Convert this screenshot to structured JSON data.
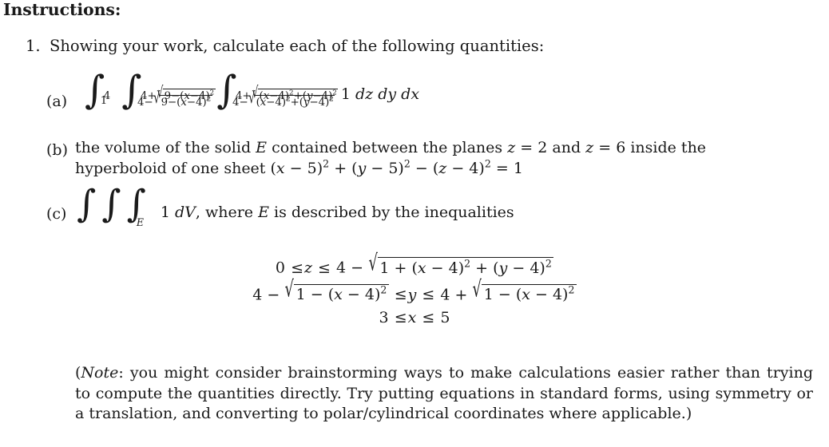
{
  "document": {
    "heading": "Instructions:",
    "item_number": "1.",
    "item_prompt": "Showing your work, calculate each of the following quantities:",
    "labels": {
      "a": "(a)",
      "b": "(b)",
      "c": "(c)"
    }
  },
  "part_a": {
    "description": "triple integral in rectangular coordinates",
    "outer_integral": {
      "lower": "1",
      "upper": "4",
      "variable": "x"
    },
    "middle_integral": {
      "lower": "4−√(9−(x−4)²)",
      "upper": "4+√(9−(x−4)²)",
      "variable": "y"
    },
    "inner_integral": {
      "lower": "4−√((x−4)²+(y−4)²)",
      "upper": "4+√((x−4)²+(y−4)²)",
      "variable": "z"
    },
    "integrand": "1",
    "differentials": "dz dy dx",
    "tokens": {
      "one": "1",
      "dz": "dz",
      "dy": "dy",
      "dx": "dx",
      "four": "4",
      "one_lim": "1",
      "nine": "9",
      "plus": "+",
      "minus": "−",
      "x": "x",
      "y": "y",
      "paren_open": "(",
      "paren_close": ")",
      "sqrt_glyph": "√",
      "exp2": "2"
    }
  },
  "part_b": {
    "line1": "the volume of the solid E contained between the planes z = 2 and z = 6 inside the",
    "line2": "hyperboloid of one sheet (x − 5)² + (y − 5)² − (z − 4)² = 1",
    "segments": {
      "s1": "the volume of the solid",
      "solid_symbol": "E",
      "s2": "contained between the planes",
      "z1": "z",
      "eq1": "=",
      "val1": "2",
      "and_word": "and",
      "z2": "z",
      "eq2": "=",
      "val2": "6",
      "s3": "inside the",
      "s4": "hyperboloid of one sheet",
      "plane_z_low": "2",
      "plane_z_high": "6"
    },
    "equation": "(x − 5)² + (y − 5)² − (z − 4)² = 1"
  },
  "part_c": {
    "integral_subscript": "E",
    "integrand": "1",
    "differential": "dV",
    "text_after": ", where",
    "region_symbol": "E",
    "text_end": "is described by the inequalities",
    "inequalities": [
      "0 ≤ z ≤ 4 − √(1 + (x − 4)² + (y − 4)²)",
      "4 − √(1 − (x − 4)²) ≤ y ≤ 4 + √(1 − (x − 4)²)",
      "3 ≤ x ≤ 5"
    ],
    "ineq1": {
      "lower": "0",
      "var": "z",
      "rhs_lead": "4",
      "op": "−",
      "inside": "1 + (x − 4)² + (y − 4)²"
    },
    "ineq2": {
      "left_lead": "4",
      "left_op": "−",
      "left_inside": "1 − (x − 4)²",
      "var": "y",
      "right_lead": "4",
      "right_op": "+",
      "right_inside": "1 − (x − 4)²"
    },
    "ineq3": {
      "lower": "3",
      "var": "x",
      "upper": "5"
    }
  },
  "note": {
    "label": "Note",
    "colon": ":",
    "body": " you might consider brainstorming ways to make calculations easier rather than trying to compute the quantities directly. Try putting equations in standard forms, using symmetry or a translation, and converting to polar/cylindrical coordinates where applicable.)",
    "open_paren": "(",
    "full_text": "(Note: you might consider brainstorming ways to make calculations easier rather than trying to compute the quantities directly. Try putting equations in standard forms, using symmetry or a translation, and converting to polar/cylindrical coordinates where applicable.)"
  },
  "symbols": {
    "leq": "≤",
    "integral": "∫",
    "radical": "√",
    "minus": "−",
    "plus": "+",
    "equals": "="
  },
  "colors": {
    "text": "#1a1a1a",
    "background": "#ffffff"
  }
}
